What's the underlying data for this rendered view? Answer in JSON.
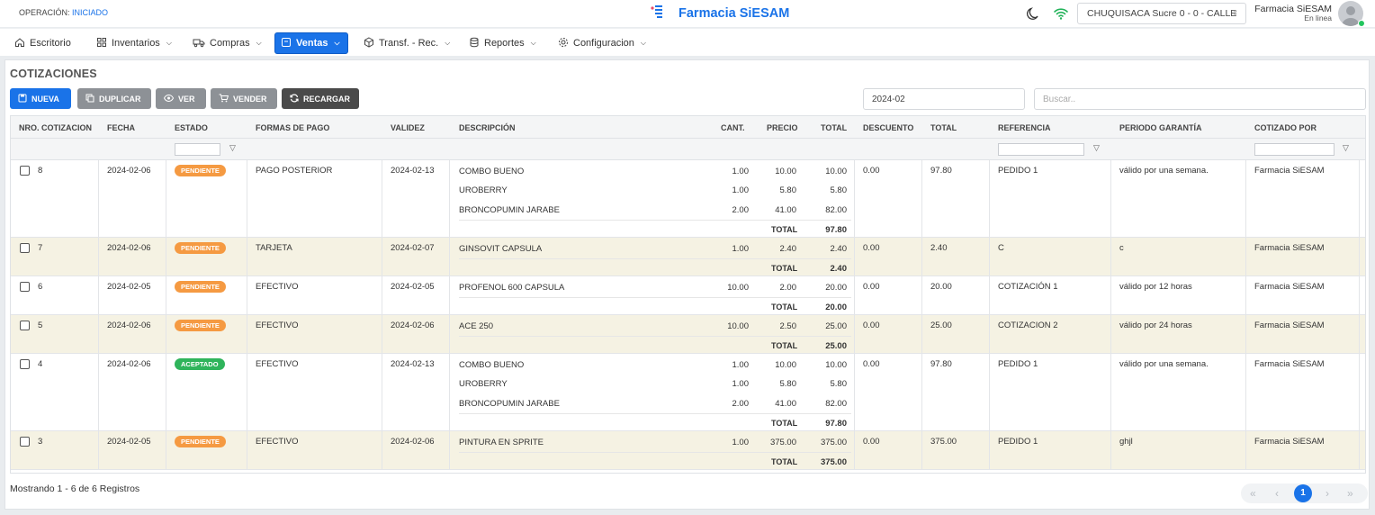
{
  "topbar": {
    "operation_label": "OPERACIÓN:",
    "operation_status": "INICIADO",
    "app_title": "Farmacia SiESAM",
    "branch": "CHUQUISACA Sucre 0 - 0 - CALLE",
    "user_name": "Farmacia SiESAM",
    "user_status": "En linea"
  },
  "nav": [
    {
      "label": "Escritorio",
      "icon": "home-icon"
    },
    {
      "label": "Inventarios",
      "icon": "grid-icon"
    },
    {
      "label": "Compras",
      "icon": "truck-icon"
    },
    {
      "label": "Ventas",
      "icon": "receipt-icon"
    },
    {
      "label": "Transf. - Rec.",
      "icon": "box-icon"
    },
    {
      "label": "Reportes",
      "icon": "database-icon"
    },
    {
      "label": "Configuracion",
      "icon": "gear-icon"
    }
  ],
  "page": {
    "title": "COTIZACIONES",
    "buttons": {
      "new": "NUEVA",
      "duplicate": "DUPLICAR",
      "view": "VER",
      "sell": "VENDER",
      "reload": "RECARGAR"
    },
    "period": "2024-02",
    "search_placeholder": "Buscar.."
  },
  "table": {
    "headers": {
      "nro": "NRO. COTIZACION",
      "fecha": "FECHA",
      "estado": "ESTADO",
      "pago": "FORMAS DE PAGO",
      "validez": "VALIDEZ",
      "desc": "DESCRIPCIÓN",
      "cant": "CANT.",
      "precio": "PRECIO",
      "total": "TOTAL",
      "descuento": "DESCUENTO",
      "total2": "TOTAL",
      "referencia": "REFERENCIA",
      "garantia": "PERIODO GARANTÍA",
      "cotizado": "COTIZADO POR"
    },
    "total_label": "TOTAL",
    "rows": [
      {
        "nro": "8",
        "fecha": "2024-02-06",
        "estado": "PENDIENTE",
        "pago": "PAGO POSTERIOR",
        "validez": "2024-02-13",
        "items": [
          {
            "desc": "COMBO BUENO",
            "cant": "1.00",
            "precio": "10.00",
            "total": "10.00"
          },
          {
            "desc": "UROBERRY",
            "cant": "1.00",
            "precio": "5.80",
            "total": "5.80"
          },
          {
            "desc": "BRONCOPUMIN JARABE",
            "cant": "2.00",
            "precio": "41.00",
            "total": "82.00"
          }
        ],
        "subtotal": "97.80",
        "descuento": "0.00",
        "total": "97.80",
        "referencia": "PEDIDO 1",
        "garantia": "válido por una semana.",
        "cotizado": "Farmacia SiESAM"
      },
      {
        "nro": "7",
        "fecha": "2024-02-06",
        "estado": "PENDIENTE",
        "pago": "TARJETA",
        "validez": "2024-02-07",
        "items": [
          {
            "desc": "GINSOVIT CAPSULA",
            "cant": "1.00",
            "precio": "2.40",
            "total": "2.40"
          }
        ],
        "subtotal": "2.40",
        "descuento": "0.00",
        "total": "2.40",
        "referencia": "C",
        "garantia": "c",
        "cotizado": "Farmacia SiESAM"
      },
      {
        "nro": "6",
        "fecha": "2024-02-05",
        "estado": "PENDIENTE",
        "pago": "EFECTIVO",
        "validez": "2024-02-05",
        "items": [
          {
            "desc": "PROFENOL 600 CAPSULA",
            "cant": "10.00",
            "precio": "2.00",
            "total": "20.00"
          }
        ],
        "subtotal": "20.00",
        "descuento": "0.00",
        "total": "20.00",
        "referencia": "COTIZACIÓN 1",
        "garantia": "válido por 12 horas",
        "cotizado": "Farmacia SiESAM"
      },
      {
        "nro": "5",
        "fecha": "2024-02-06",
        "estado": "PENDIENTE",
        "pago": "EFECTIVO",
        "validez": "2024-02-06",
        "items": [
          {
            "desc": "ACE 250",
            "cant": "10.00",
            "precio": "2.50",
            "total": "25.00"
          }
        ],
        "subtotal": "25.00",
        "descuento": "0.00",
        "total": "25.00",
        "referencia": "COTIZACION 2",
        "garantia": "válido por 24 horas",
        "cotizado": "Farmacia SiESAM"
      },
      {
        "nro": "4",
        "fecha": "2024-02-06",
        "estado": "ACEPTADO",
        "pago": "EFECTIVO",
        "validez": "2024-02-13",
        "items": [
          {
            "desc": "COMBO BUENO",
            "cant": "1.00",
            "precio": "10.00",
            "total": "10.00"
          },
          {
            "desc": "UROBERRY",
            "cant": "1.00",
            "precio": "5.80",
            "total": "5.80"
          },
          {
            "desc": "BRONCOPUMIN JARABE",
            "cant": "2.00",
            "precio": "41.00",
            "total": "82.00"
          }
        ],
        "subtotal": "97.80",
        "descuento": "0.00",
        "total": "97.80",
        "referencia": "PEDIDO 1",
        "garantia": "válido por una semana.",
        "cotizado": "Farmacia SiESAM"
      },
      {
        "nro": "3",
        "fecha": "2024-02-05",
        "estado": "PENDIENTE",
        "pago": "EFECTIVO",
        "validez": "2024-02-06",
        "items": [
          {
            "desc": "PINTURA EN SPRITE",
            "cant": "1.00",
            "precio": "375.00",
            "total": "375.00"
          }
        ],
        "subtotal": "375.00",
        "descuento": "0.00",
        "total": "375.00",
        "referencia": "PEDIDO 1",
        "garantia": "ghjl",
        "cotizado": "Farmacia SiESAM"
      }
    ]
  },
  "footer": {
    "records": "Mostrando 1 - 6 de 6 Registros",
    "current_page": "1"
  },
  "colors": {
    "accent": "#1a73e8",
    "pending": "#f59a42",
    "accepted": "#2fb45b",
    "alt_row": "#f5f2e3"
  }
}
